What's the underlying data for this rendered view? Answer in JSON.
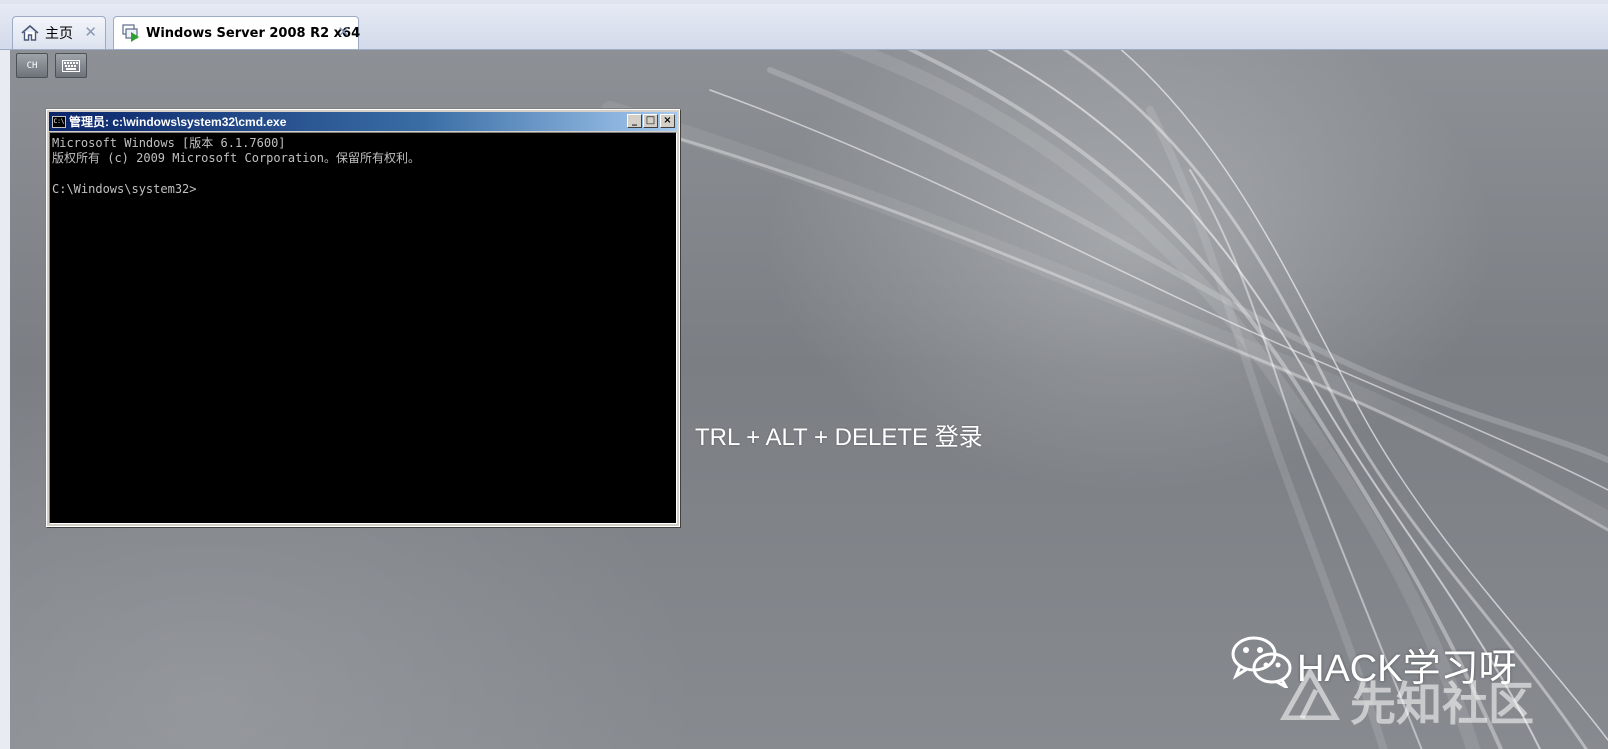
{
  "tabs": [
    {
      "label": "主页",
      "icon": "home-icon",
      "active": false
    },
    {
      "label": "Windows Server 2008 R2 x64",
      "icon": "vm-running-icon",
      "active": true
    }
  ],
  "tab_close_glyph": "✕",
  "vm_toolbar": {
    "ime_label": "CH",
    "keyboard_icon": "keyboard-icon"
  },
  "login_hint": "TRL + ALT + DELETE 登录",
  "cmd_window": {
    "title": "管理员: c:\\windows\\system32\\cmd.exe",
    "icon_label": "C:\\",
    "minimize": "_",
    "maximize": "□",
    "close": "×",
    "lines": [
      "Microsoft Windows [版本 6.1.7600]",
      "版权所有 (c) 2009 Microsoft Corporation。保留所有权利。",
      "",
      "C:\\Windows\\system32>"
    ]
  },
  "watermark": {
    "wechat_icon": "wechat-icon",
    "channel": "HACK学习呀",
    "site": "先知社区",
    "site_logo": "xianzhi-logo-icon"
  },
  "colors": {
    "tabbar_bg": "#d3daea",
    "titlebar_start": "#0a246a",
    "titlebar_end": "#a6caf0",
    "console_bg": "#000000",
    "console_fg": "#c0c0c0"
  }
}
